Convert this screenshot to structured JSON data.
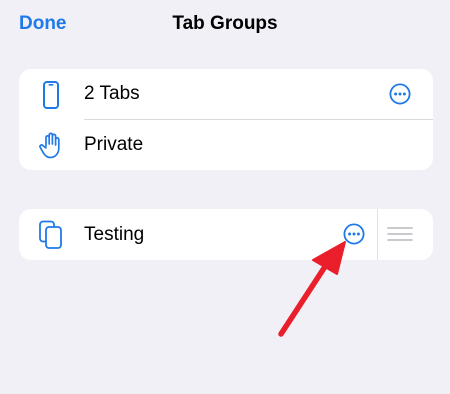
{
  "nav": {
    "done_label": "Done",
    "title": "Tab Groups"
  },
  "groups": [
    {
      "label": "2 Tabs",
      "icon": "iphone-icon",
      "has_more": true
    },
    {
      "label": "Private",
      "icon": "hand-raised-icon",
      "has_more": false
    }
  ],
  "user_groups": [
    {
      "label": "Testing",
      "icon": "square-on-square-icon",
      "has_more": true,
      "draggable": true
    }
  ],
  "annotation": {
    "arrow_color": "#ea1f2b",
    "arrow_target": "testing-more-button"
  },
  "colors": {
    "accent": "#1f7ae8",
    "background": "#f1f0f6",
    "card": "#ffffff"
  }
}
